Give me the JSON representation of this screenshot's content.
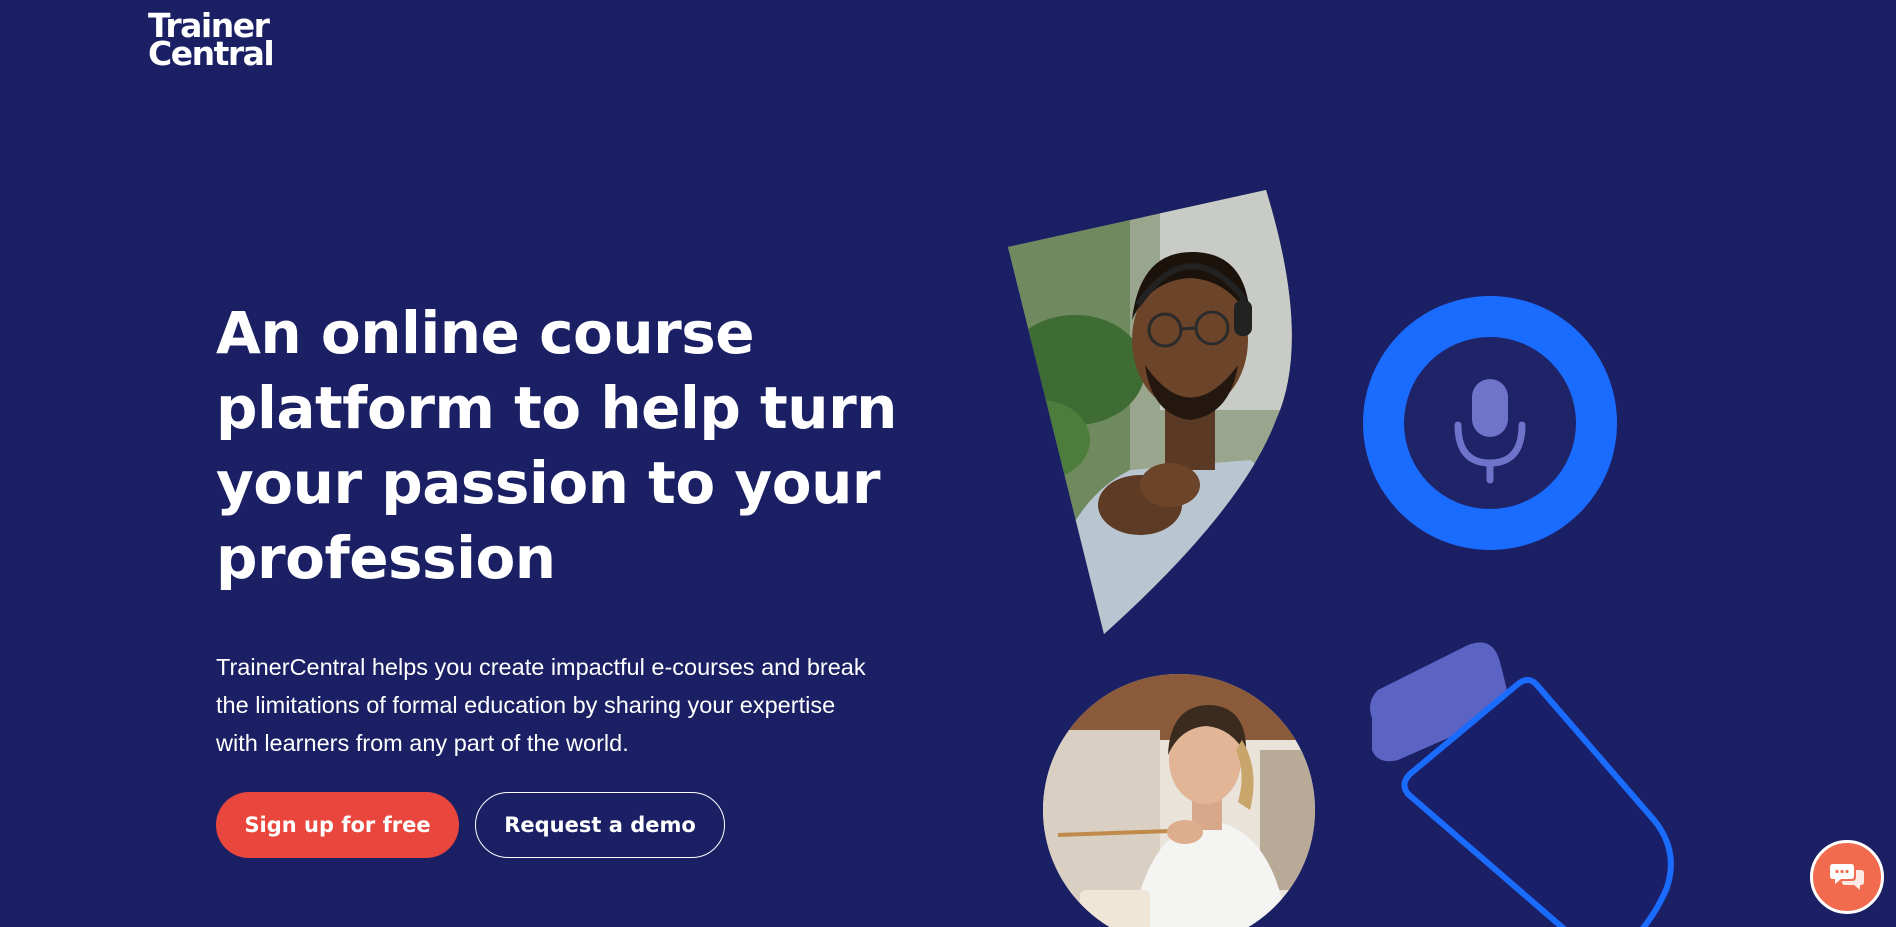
{
  "brand": {
    "logo_line1": "Trainer",
    "logo_line2": "Central"
  },
  "hero": {
    "headline": "An online course platform to help turn your passion to your profession",
    "description": "TrainerCentral helps you create impactful e-courses and break the limitations of formal education by sharing your expertise with learners from any part of the world.",
    "primary_cta": "Sign up for free",
    "secondary_cta": "Request a demo"
  },
  "colors": {
    "background": "#1b2064",
    "primary_button": "#e9473d",
    "accent_blue": "#1a6cff",
    "mic_inner": "#1f2468",
    "mic_glyph": "#6f73c9",
    "shape_lavender": "#5b63c3",
    "chat_button": "#f26b4f"
  },
  "icons": {
    "mic": "microphone-icon",
    "chat": "chat-icon"
  }
}
